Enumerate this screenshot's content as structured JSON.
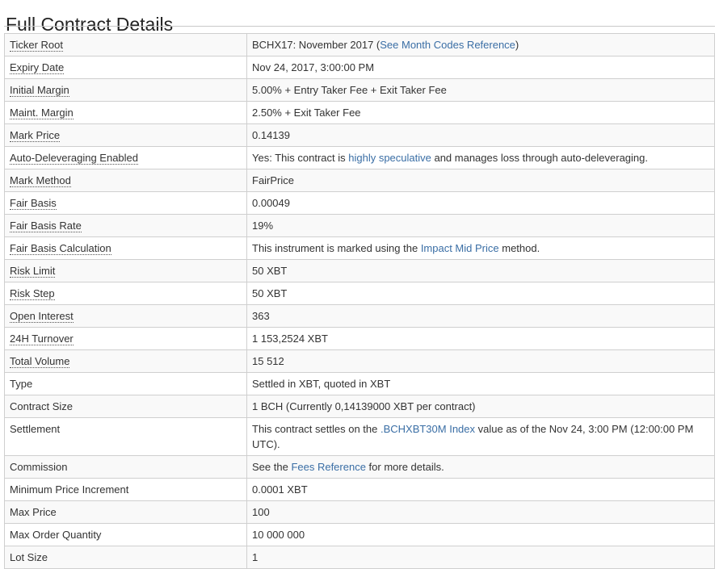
{
  "page": {
    "title": "Full Contract Details"
  },
  "rows": {
    "ticker_root": {
      "label": "Ticker Root",
      "value_pre": "BCHX17: November 2017 (",
      "link": "See Month Codes Reference",
      "value_post": ")"
    },
    "expiry_date": {
      "label": "Expiry Date",
      "value": "Nov 24, 2017, 3:00:00 PM"
    },
    "initial_margin": {
      "label": "Initial Margin",
      "value": "5.00% + Entry Taker Fee + Exit Taker Fee"
    },
    "maint_margin": {
      "label": "Maint. Margin",
      "value": "2.50% + Exit Taker Fee"
    },
    "mark_price": {
      "label": "Mark Price",
      "value": "0.14139"
    },
    "auto_deleveraging": {
      "label": "Auto-Deleveraging Enabled",
      "value_pre": "Yes: This contract is ",
      "link": "highly speculative",
      "value_post": " and manages loss through auto-deleveraging."
    },
    "mark_method": {
      "label": "Mark Method",
      "value": "FairPrice"
    },
    "fair_basis": {
      "label": "Fair Basis",
      "value": "0.00049"
    },
    "fair_basis_rate": {
      "label": "Fair Basis Rate",
      "value": "19%"
    },
    "fair_basis_calc": {
      "label": "Fair Basis Calculation",
      "value_pre": "This instrument is marked using the ",
      "link": "Impact Mid Price",
      "value_post": " method."
    },
    "risk_limit": {
      "label": "Risk Limit",
      "value": "50 XBT"
    },
    "risk_step": {
      "label": "Risk Step",
      "value": "50 XBT"
    },
    "open_interest": {
      "label": "Open Interest",
      "value": "363"
    },
    "turnover_24h": {
      "label": "24H Turnover",
      "value": "1 153,2524 XBT"
    },
    "total_volume": {
      "label": "Total Volume",
      "value": "15 512"
    },
    "type": {
      "label": "Type",
      "value": "Settled in XBT, quoted in XBT"
    },
    "contract_size": {
      "label": "Contract Size",
      "value": "1 BCH (Currently 0,14139000 XBT per contract)"
    },
    "settlement": {
      "label": "Settlement",
      "value_pre": "This contract settles on the ",
      "link": ".BCHXBT30M Index",
      "value_post": " value as of the Nov 24, 3:00 PM (12:00:00 PM UTC)."
    },
    "commission": {
      "label": "Commission",
      "value_pre": "See the ",
      "link": "Fees Reference",
      "value_post": " for more details."
    },
    "min_price_increment": {
      "label": "Minimum Price Increment",
      "value": "0.0001 XBT"
    },
    "max_price": {
      "label": "Max Price",
      "value": "100"
    },
    "max_order_qty": {
      "label": "Max Order Quantity",
      "value": "10 000 000"
    },
    "lot_size": {
      "label": "Lot Size",
      "value": "1"
    }
  },
  "colors": {
    "link": "#3a6ea5",
    "border": "#cfcfcf",
    "stripe": "#f9f9f9"
  }
}
